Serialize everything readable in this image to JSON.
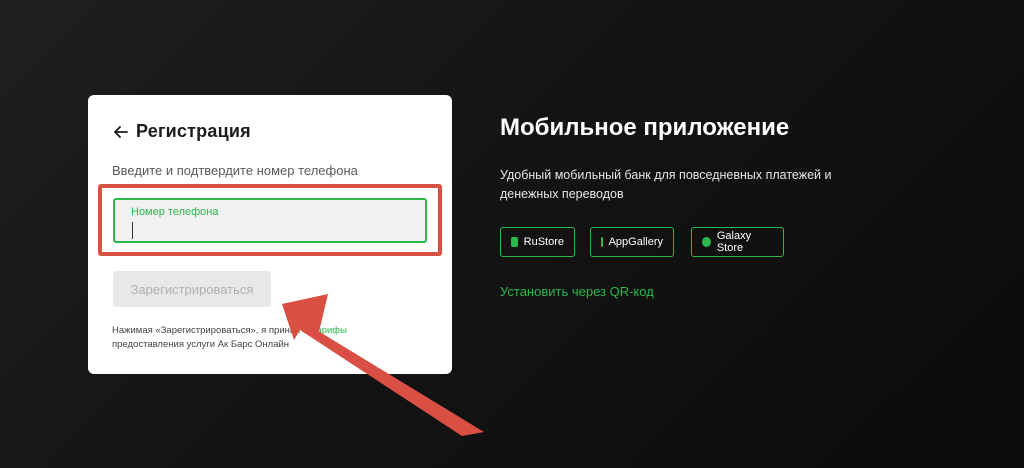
{
  "registration": {
    "title": "Регистрация",
    "subtitle": "Введите и подтвердите номер телефона",
    "phone_label": "Номер телефона",
    "phone_value": "",
    "register_button": "Зарегистрироваться",
    "terms_prefix": "Нажимая «Зарегистрироваться», я прини",
    "terms_link1": "а",
    "terms_and": " и ",
    "terms_link2": "Тарифы",
    "terms_suffix": "предоставления услуги Ак Барс Онлайн"
  },
  "promo": {
    "title": "Мобильное приложение",
    "description": "Удобный мобильный банк для повседневных платежей и денежных переводов",
    "stores": [
      {
        "label": "RuStore",
        "icon": "rustore-icon"
      },
      {
        "label": "AppGallery",
        "icon": "appgallery-icon"
      },
      {
        "label": "Galaxy Store",
        "icon": "galaxy-store-icon"
      }
    ],
    "qr_link": "Установить через QR-код"
  },
  "colors": {
    "accent": "#2cb84a",
    "annotation": "#d94f44",
    "background": "#141414",
    "card": "#ffffff"
  }
}
